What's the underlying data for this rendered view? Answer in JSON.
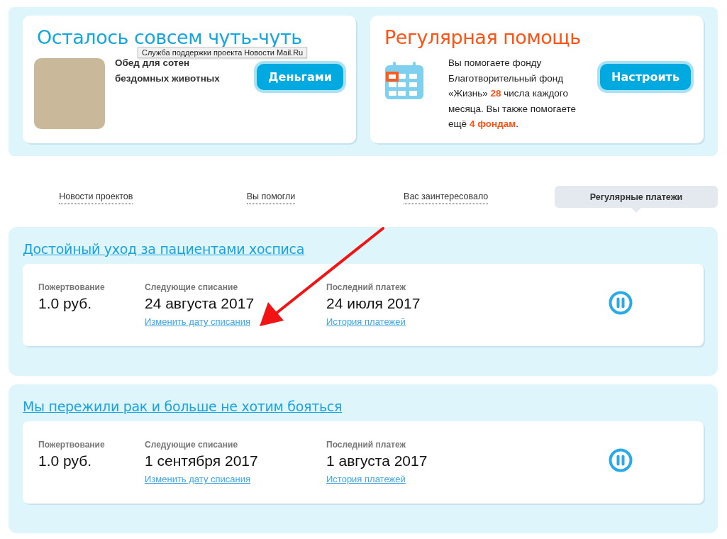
{
  "promo_cards": [
    {
      "kind": "campaign",
      "title": "Осталось совсем чуть-чуть",
      "description": "Обед для сотен бездомных животных",
      "button": "Деньгами",
      "tooltip": "Служба поддержки проекта Новости Mail.Ru"
    },
    {
      "kind": "regular",
      "title": "Регулярная помощь",
      "description": "Вы помогаете фонду Благотворительный фонд «Жизнь» **28** числа каждого месяца. Вы также помогаете ещё **4 фондам**.",
      "button": "Настроить"
    }
  ],
  "tabs": [
    {
      "label": "Новости проектов",
      "selected": false
    },
    {
      "label": "Вы помогли",
      "selected": false
    },
    {
      "label": "Вас заинтересовало",
      "selected": false
    },
    {
      "label": "Регулярные платежи",
      "selected": true
    }
  ],
  "subscriptions": [
    {
      "title": "Достойный уход за пациентами хосписа",
      "donation_label": "Пожертвование",
      "donation": "1.0 руб.",
      "next_label": "Следующие списание",
      "next_date": "24 августа 2017",
      "change_link": "Изменить дату списания",
      "last_label": "Последний платеж",
      "last_date": "24 июля 2017",
      "history_link": "История платежей"
    },
    {
      "title": "Мы пережили рак и больше не хотим бояться",
      "donation_label": "Пожертвование",
      "donation": "1.0 руб.",
      "next_label": "Следующие списание",
      "next_date": "1 сентября 2017",
      "change_link": "Изменить дату списания",
      "last_label": "Последний платеж",
      "last_date": "1 августа 2017",
      "history_link": "История платежей"
    }
  ]
}
